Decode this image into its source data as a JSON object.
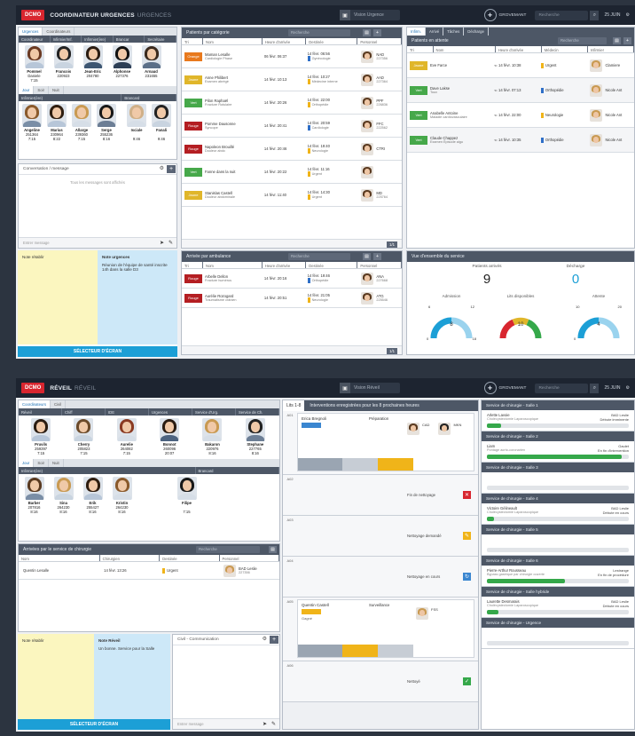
{
  "screen1": {
    "logo": "DCMO",
    "title": "COORDINATEUR URGENCES",
    "subtitle": "URGENCES",
    "pill": "Vision Urgence",
    "user": "GROVEMANT",
    "search": "Recherche",
    "date": "25 JUIN",
    "staff": {
      "tabs": [
        "Urgences",
        "Coordinateurs"
      ],
      "cols": [
        "Coordinateur",
        "Infirmier/Inf.",
        "Infirmier(ère)",
        "Brancar",
        "Secrétaire"
      ],
      "people": [
        {
          "name": "Pommel",
          "sub": "Daniele",
          "code": "20:07",
          "time": "7:15",
          "hair": "#6b3a22",
          "body": "#b7c6d8"
        },
        {
          "name": "Francois",
          "sub": "220923",
          "code": "9:06",
          "time": "",
          "hair": "#222",
          "body": "#c9d4e0"
        },
        {
          "name": "Jean-Eric",
          "sub": "204780",
          "code": "7:15",
          "time": "",
          "hair": "#2a1c12",
          "body": "#3d5672"
        },
        {
          "name": "Alphonse",
          "sub": "227376",
          "code": "20:07",
          "time": "",
          "hair": "#111",
          "body": "#2c3e55"
        },
        {
          "name": "Arnaud",
          "sub": "231655",
          "code": "7:15",
          "time": "",
          "hair": "#3a2a1e",
          "body": "#5b6f88"
        }
      ],
      "shiftTabs": [
        "Jour",
        "Soir",
        "Nuit"
      ],
      "groups": [
        "Infirmier(ère)",
        "Brancard"
      ],
      "people2": [
        {
          "name": "Angeline",
          "sub": "251364",
          "time": "7:15",
          "hair": "#8a5a2c",
          "body": "#7a8ea6"
        },
        {
          "name": "Marius",
          "sub": "230964",
          "time": "8:22",
          "hair": "#2f1e10",
          "body": "#b7c6d8"
        },
        {
          "name": "Allarge",
          "sub": "239360",
          "time": "7:15",
          "hair": "#c99a52",
          "body": "#d6dee7"
        },
        {
          "name": "Serge",
          "sub": "255236",
          "time": "8:16",
          "hair": "#181818",
          "body": "#6c7e95"
        }
      ],
      "people3": [
        {
          "name": "Isciale",
          "sub": "",
          "time": "9:46",
          "hair": "#d0b088",
          "body": "#d6dee7"
        },
        {
          "name": "Fanali",
          "sub": "",
          "time": "9:46",
          "hair": "#222",
          "body": "#c9d4e0"
        }
      ]
    },
    "chat": {
      "title": "Conversation / message",
      "empty": "Tous les messages sont affichés",
      "input": "Entrer message"
    },
    "notes": {
      "yellow": "Note rétablir",
      "blueTitle": "Note urgences",
      "blueText": "Réunion de l'équipe de santé inscrite 14h dans la salle D3"
    },
    "button": "SÉLECTEUR D'ÉCRAN",
    "triage": {
      "title": "Patients par catégorie",
      "search": "Recherche",
      "cols": [
        "Tri",
        "Nom",
        "Heure d'arrivée",
        "Destinée",
        "Personnel"
      ],
      "rows": [
        {
          "tag": "Orange",
          "tc": "#e8791d",
          "name": "Maman Lesalle",
          "desc": "Cardiologie Phase",
          "arr": "06 févr. 06:37",
          "dest": "14 févr. 06:56",
          "destDesc": "Gynécologie",
          "dc": "#2f6fc7",
          "staff": "NAD",
          "sid": "227356"
        },
        {
          "tag": "Jaune",
          "tc": "#e0b62a",
          "name": "Anne Philibert",
          "desc": "Examen abrégé",
          "arr": "14 févr. 10:13",
          "dest": "14 févr. 10:27",
          "destDesc": "Médecine interne",
          "dc": "#f0b419",
          "staff": "AAD",
          "sid": "227364"
        },
        {
          "tag": "Vert",
          "tc": "#46a84a",
          "name": "Pilon Raphaël",
          "desc": "Fracture Rotulaire",
          "arr": "14 févr. 20:26",
          "dest": "14 févr. 22:00",
          "destDesc": "Orthopédie",
          "dc": "#f0b419",
          "staff": "PPF",
          "sid": "226836"
        },
        {
          "tag": "Rouge",
          "tc": "#b41e22",
          "name": "Pomme Dausonne",
          "desc": "Syncope",
          "arr": "14 févr. 20:41",
          "dest": "14 févr. 20:59",
          "destDesc": "Cardiologie",
          "dc": "#2f6fc7",
          "staff": "FFC",
          "sid": "222562"
        },
        {
          "tag": "Rouge",
          "tc": "#b41e22",
          "name": "Napoleon Brouillé",
          "desc": "Douleur abdo",
          "arr": "14 févr. 20:46",
          "dest": "14 févr. 19:40",
          "destDesc": "Neurologie",
          "dc": "#f0b419",
          "staff": "CTRI",
          "sid": ""
        },
        {
          "tag": "Vert",
          "tc": "#46a84a",
          "name": "Fanne dans la nuit",
          "desc": "",
          "arr": "14 févr. 20:22",
          "dest": "14 févr. 11:16",
          "destDesc": "Urgent",
          "dc": "#f0b419",
          "staff": "",
          "sid": ""
        },
        {
          "tag": "Jaune",
          "tc": "#e0b62a",
          "name": "Stanislas Castell",
          "desc": "Douleur abdominale",
          "arr": "14 févr. 11:40",
          "dest": "14 févr. 14:30",
          "destDesc": "Urgent",
          "dc": "#f0b419",
          "staff": "MD",
          "sid": "225764"
        }
      ],
      "page": "1/1"
    },
    "ambu": {
      "title": "Arrivée par ambulance",
      "search": "Recherche",
      "cols": [
        "Tri",
        "Nom",
        "Heure d'arrivée",
        "Destinée",
        "Personnel"
      ],
      "rows": [
        {
          "tag": "Rouge",
          "tc": "#b41e22",
          "name": "Arbelle Dellon",
          "desc": "Fracture humérus",
          "arr": "14 févr. 20:16",
          "dest": "14 févr. 19:46",
          "destDesc": "Orthopédie",
          "dc": "#2f6fc7",
          "staff": "ANA",
          "sid": "227668"
        },
        {
          "tag": "Rouge",
          "tc": "#b41e22",
          "name": "Aurélie Rozogard",
          "desc": "Traumatisme crânien",
          "arr": "14 févr. 20:51",
          "dest": "14 févr. 21:05",
          "destDesc": "Neurologie",
          "dc": "#f0b419",
          "staff": "ATG",
          "sid": "225546"
        }
      ],
      "page": "1/1"
    },
    "right": {
      "tabs": [
        "Infirm.",
        "Arrivé",
        "Tâches",
        "Décharge"
      ],
      "title": "Patients en attente",
      "search": "Recherche",
      "cols": [
        "Tri",
        "Nom",
        "Heure d'arrivée",
        "Médecin",
        "Infirmier"
      ],
      "rows": [
        {
          "tag": "Jaune",
          "tc": "#e0b62a",
          "name": "Eve Farce",
          "desc": "",
          "arr": "14 févr. 10:38",
          "dest": "Urgent",
          "dc": "#f0b419",
          "staff": "Clamiere"
        },
        {
          "tag": "Vert",
          "tc": "#46a84a",
          "name": "Dave Lakse",
          "desc": "Toux",
          "arr": "14 févr. 07:13",
          "dest": "Orthopédie",
          "dc": "#2f6fc7",
          "staff": "Nicole Ant"
        },
        {
          "tag": "Vert",
          "tc": "#46a84a",
          "name": "Anabelle Antoine",
          "desc": "Maladie cardiovasculaire",
          "arr": "14 févr. 22:00",
          "dest": "Neurologie",
          "dc": "#f0b419",
          "staff": "Nicole Ant"
        },
        {
          "tag": "Vert",
          "tc": "#46a84a",
          "name": "Claude Chappez",
          "desc": "Examen Épisode aigu",
          "arr": "14 févr. 10:35",
          "dest": "Orthopédie",
          "dc": "#2f6fc7",
          "staff": "Nicole Ant"
        }
      ]
    },
    "service": {
      "title": "Vue d'ensemble du service",
      "arrived": "Patients arrivés",
      "arrivedNum": "9",
      "discharge": "Décharge",
      "dischargeNum": "0",
      "gauges": [
        {
          "label": "Admission",
          "value": "8",
          "min": "0",
          "max": "18",
          "mark1": "6",
          "mark2": "12"
        },
        {
          "label": "Lits disponibles",
          "value": "10",
          "min": "",
          "max": "",
          "mark1": "",
          "mark2": ""
        },
        {
          "label": "Attente",
          "value": "4",
          "min": "0",
          "max": "",
          "mark1": "10",
          "mark2": "20"
        }
      ]
    }
  },
  "screen2": {
    "logo": "DCMO",
    "title": "RÉVEIL",
    "subtitle": "RÉVEIL",
    "pill": "Vision Réveil",
    "user": "GROVEMANT",
    "search": "Recherche",
    "date": "25 JUIN",
    "staff": {
      "tabs": [
        "Coordinateurs",
        "Civil"
      ],
      "cols": [
        "Réveil",
        "Chiff",
        "IDE",
        "Urgences",
        "Service d'Urg.",
        "Service de Ch."
      ],
      "people": [
        {
          "name": "Pruvils",
          "sub": "259397",
          "time": "7:15",
          "hair": "#2b1d12",
          "body": "#b7c6d8"
        },
        {
          "name": "Cherry",
          "sub": "205823",
          "time": "7:15",
          "hair": "#6b4a2a",
          "body": "#c9d4e0"
        },
        {
          "name": "Aurelie",
          "sub": "264082",
          "time": "7:15",
          "hair": "#8a3a22",
          "body": "#d6dee7"
        },
        {
          "name": "Bonnot",
          "sub": "260096",
          "time": "20:07",
          "hair": "#2a1c12",
          "body": "#4c6380"
        },
        {
          "name": "Bakaron",
          "sub": "220976",
          "time": "8:16",
          "hair": "#c99a52",
          "body": "#d6dee7"
        },
        {
          "name": "Stephane",
          "sub": "227765",
          "time": "8:16",
          "hair": "#222",
          "body": "#6c7e95"
        }
      ],
      "shiftTabs": [
        "Jour",
        "Soir",
        "Nuit"
      ],
      "groups": [
        "Infirmier(ère)",
        "Brancard"
      ],
      "people2": [
        {
          "name": "Barber",
          "sub": "207816",
          "time": "8:16",
          "hair": "#5a3a20",
          "body": "#7a8ea6"
        },
        {
          "name": "Sina",
          "sub": "264230",
          "time": "8:16",
          "hair": "#c99a52",
          "body": "#c9d4e0"
        },
        {
          "name": "Erik",
          "sub": "255427",
          "time": "8:16",
          "hair": "#2f1e10",
          "body": "#b7c6d8"
        },
        {
          "name": "Kristin",
          "sub": "264230",
          "time": "8:16",
          "hair": "#8a5a2c",
          "body": "#d6dee7"
        }
      ],
      "people3": [
        {
          "name": "Filipe",
          "sub": "",
          "time": "7:15",
          "hair": "#181818",
          "body": "#d6dee7"
        }
      ]
    },
    "surgery": {
      "title": "Arrivées par le service de chirurgie",
      "search": "Recherche",
      "cols": [
        "Nom",
        "Chirurgien",
        "Destinée",
        "Personnel"
      ],
      "rows": [
        {
          "name": "Quentin Lesalle",
          "surg": "14 févr. 13:26",
          "dest": "Urgent",
          "staff": "BAD Leslie",
          "sid": "227356"
        }
      ]
    },
    "notes": {
      "yellow": "Note rétablir",
      "blueTitle": "Note Réveil",
      "blueText": "Un bonne. Service pour la Salle"
    },
    "chat": {
      "title": "Civil - Communication",
      "input": "Entrer message"
    },
    "button": "SÉLECTEUR D'ÉCRAN",
    "wards": {
      "tabs": [
        "Lits 1-8"
      ],
      "title": "Interventions enregistrées pour les 8 prochaines heures",
      "items": [
        {
          "label": "A01",
          "text": "",
          "kind": "patient"
        },
        {
          "label": "A02",
          "text": "Fin de nettoyage",
          "icon": "red"
        },
        {
          "label": "A03",
          "text": "Nettoyage demandé",
          "icon": "yellow"
        },
        {
          "label": "A04",
          "text": "Nettoyage en cours",
          "icon": "blue"
        },
        {
          "label": "A05",
          "text": "",
          "kind": "patient2"
        },
        {
          "label": "A06",
          "text": "Nettoyé",
          "icon": "green"
        }
      ],
      "p1": {
        "name": "Erica Bregnoli",
        "state": "Préparation",
        "staff": "CAD",
        "staff2": "MKN",
        "sid": "207351",
        "sid2": "226891"
      },
      "p2": {
        "name": "Quentin Castell",
        "state": "Surveillance",
        "staff": "FSS",
        "sid": "225548",
        "sub": "Gagné"
      }
    },
    "rooms": [
      {
        "title": "Service de chirurgie - Salle 1",
        "text": "Arlette Lavoie",
        "desc": "Cholécystectomie Laparoscopique",
        "right": "BAD Leslie",
        "right2": "Débute imminente",
        "bar": 0.1
      },
      {
        "title": "Service de chirurgie - Salle 2",
        "text": "Liam",
        "desc": "Pontage aorto-coronarien",
        "right": "Gaulet",
        "right2": "En fin d'intervention",
        "bar": 0.95
      },
      {
        "title": "Service de chirurgie - Salle 3",
        "text": "",
        "desc": "",
        "right": "",
        "right2": "",
        "bar": 0
      },
      {
        "title": "Service de chirurgie - Salle 4",
        "text": "Victoire Gélineault",
        "desc": "Cholécystectomie Laparoscopique",
        "right": "BAD Leslie",
        "right2": "Débute en cours",
        "bar": 0.05
      },
      {
        "title": "Service de chirurgie - Salle 5",
        "text": "",
        "desc": "",
        "right": "",
        "right2": "",
        "bar": 0
      },
      {
        "title": "Service de chirurgie - Salle 6",
        "text": "Pierre-Arthur Rousseau",
        "desc": "Bypass gastrique par chirurgie ouverte",
        "right": "Lestrange",
        "right2": "En fin de procédure",
        "bar": 0.55
      },
      {
        "title": "Service de chirurgie - Salle hybride",
        "text": "Laurette Desmarais",
        "desc": "Cholécystectomie Laparoscopique",
        "right": "BAD Leslie",
        "right2": "Débute en cours",
        "bar": 0.08
      },
      {
        "title": "Service de chirurgie - Urgence",
        "text": "",
        "desc": "",
        "right": "",
        "right2": "",
        "bar": 0
      }
    ]
  }
}
